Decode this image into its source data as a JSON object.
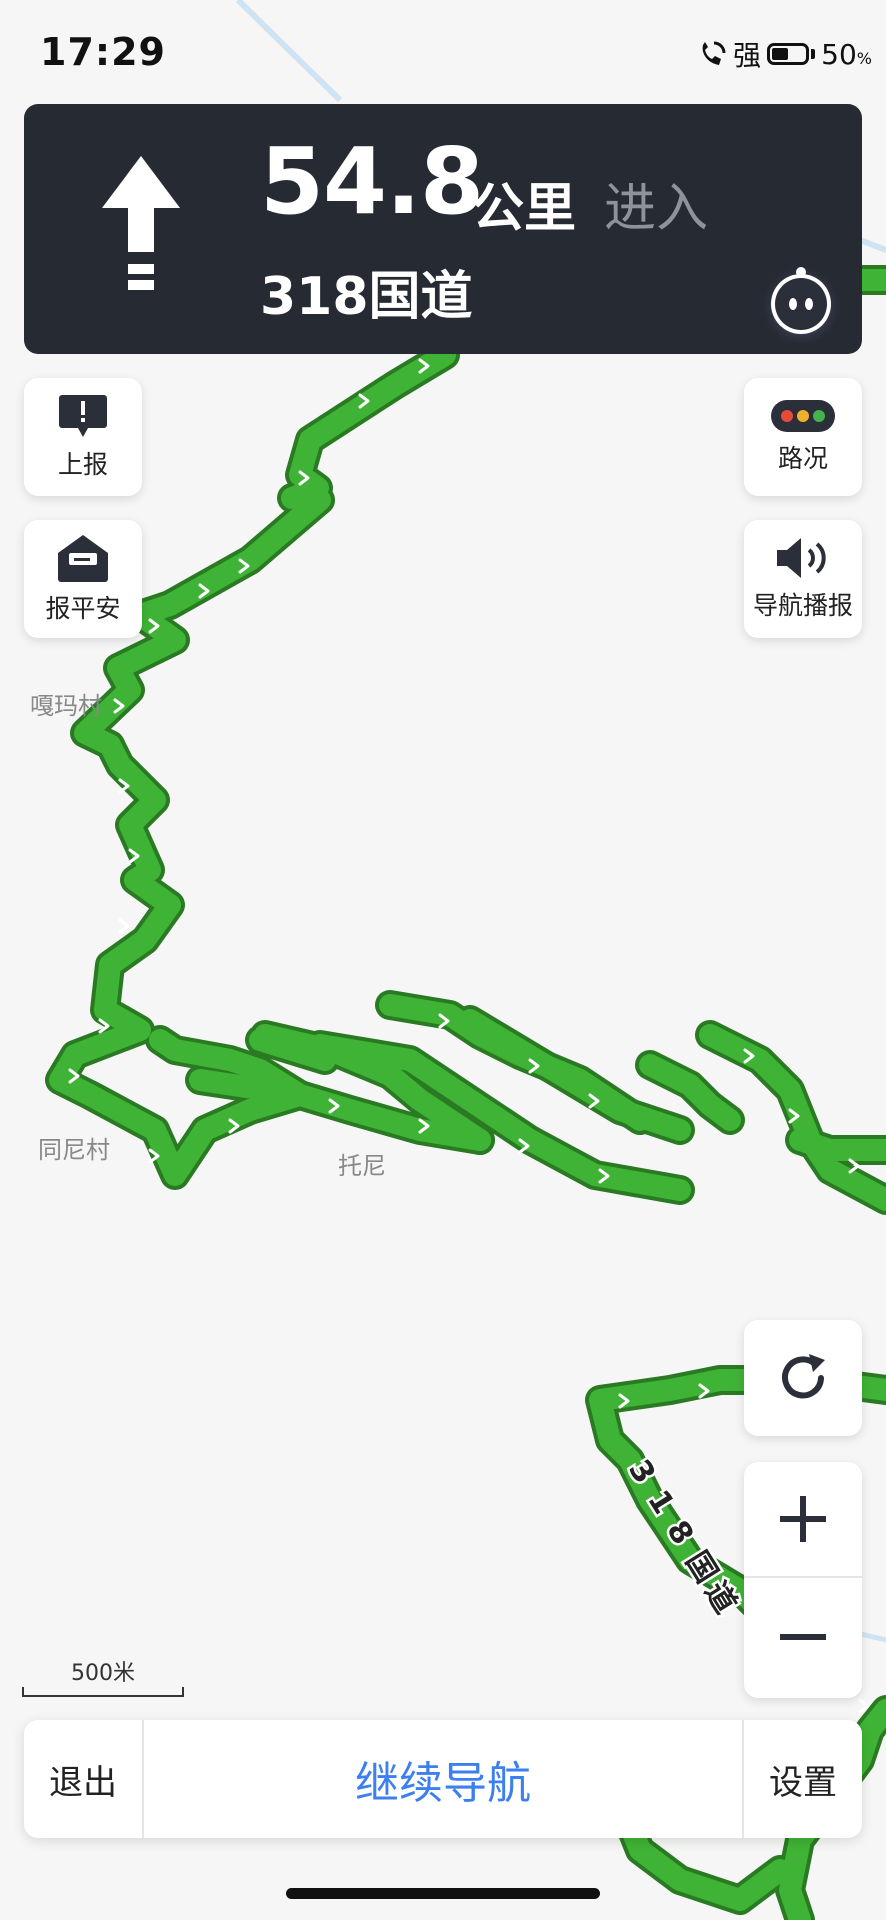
{
  "status_bar": {
    "time": "17:29",
    "signal": "强",
    "battery_pct": "50",
    "battery_unit": "%"
  },
  "guidance": {
    "distance": "54.8",
    "unit": "公里",
    "action": "进入",
    "road": "318国道",
    "maneuver_icon": "straight-arrow-icon"
  },
  "side_buttons": {
    "report": "上报",
    "safe": "报平安",
    "traffic": "路况",
    "voice": "导航播报"
  },
  "map": {
    "labels": {
      "gama": "嘎玛村",
      "tongni": "同尼村",
      "tuoni": "托尼"
    },
    "road_shield": "318国道",
    "route_color": "#3fb335",
    "route_border": "#2a7a23"
  },
  "scale": {
    "label": "500米"
  },
  "bottom_bar": {
    "exit": "退出",
    "continue": "继续导航",
    "settings": "设置"
  },
  "colors": {
    "accent": "#3d7ff0",
    "panel_bg": "#252a33"
  }
}
